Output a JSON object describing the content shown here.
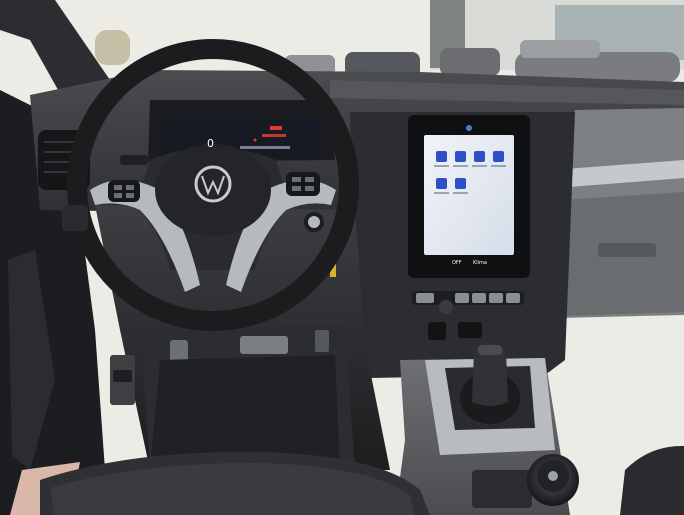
{
  "photo": {
    "subject": "vehicle-interior-dashboard",
    "brand_logo": "VW",
    "colors": {
      "cabin_dark": "#1f2124",
      "dash_gray": "#3a3c3f",
      "trim_silver": "#b9bcbe",
      "infotainment_screen": "#dfe6f1",
      "app_icon_blue": "#2f4fc8",
      "cluster_display": "#171a22",
      "cluster_red": "#e03a2a",
      "window_daylight": "#f3f2ee",
      "parking_lot_car": "#6d6f73"
    }
  },
  "instrument_cluster": {
    "speed_readout": "0"
  },
  "infotainment": {
    "bottom_bar": {
      "left": "OFF",
      "center": "Klima"
    }
  }
}
